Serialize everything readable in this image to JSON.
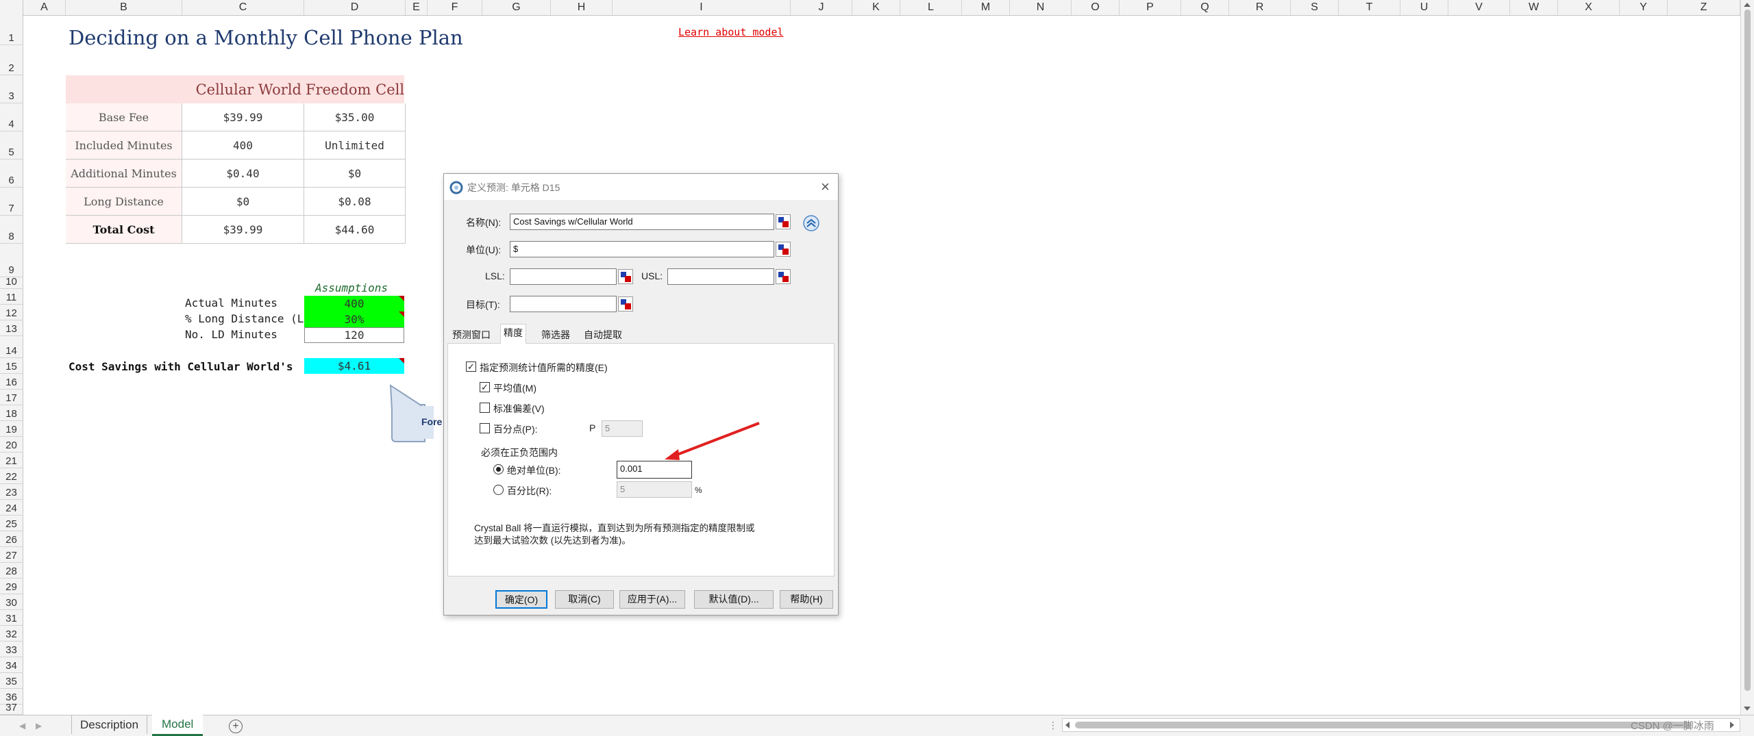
{
  "columns": [
    "A",
    "B",
    "C",
    "D",
    "E",
    "F",
    "G",
    "H",
    "I",
    "J",
    "K",
    "L",
    "M",
    "N",
    "O",
    "P",
    "Q",
    "R",
    "S",
    "T",
    "U",
    "V",
    "W",
    "X",
    "Y",
    "Z"
  ],
  "rows": [
    "1",
    "2",
    "3",
    "4",
    "5",
    "6",
    "7",
    "8",
    "9",
    "10",
    "11",
    "12",
    "13",
    "14",
    "15",
    "16",
    "17",
    "18",
    "19",
    "20",
    "21",
    "22",
    "23",
    "24",
    "25",
    "26",
    "27",
    "28",
    "29",
    "30",
    "31",
    "32",
    "33",
    "34",
    "35",
    "36",
    "37"
  ],
  "sheet": {
    "title": "Deciding on a Monthly Cell Phone Plan",
    "learn_link": "Learn about model",
    "table_headers": [
      "Cellular World",
      "Freedom Cell"
    ],
    "table_rows": [
      {
        "label": "Base Fee",
        "c": "$39.99",
        "d": "$35.00"
      },
      {
        "label": "Included Minutes",
        "c": "400",
        "d": "Unlimited"
      },
      {
        "label": "Additional Minutes",
        "c": "$0.40",
        "d": "$0"
      },
      {
        "label": "Long Distance",
        "c": "$0",
        "d": "$0.08"
      },
      {
        "label": "Total Cost",
        "c": "$39.99",
        "d": "$44.60"
      }
    ],
    "assumptions_header": "Assumptions",
    "assumptions": [
      {
        "label": "Actual Minutes",
        "value": "400"
      },
      {
        "label": "% Long Distance (LD",
        "value": "30%"
      },
      {
        "label": "No. LD Minutes",
        "value": "120"
      }
    ],
    "savings_label": "Cost Savings with Cellular World's",
    "savings_value": "$4.61",
    "callout_text": "Fore",
    "colors": {
      "green": "#00ff00",
      "cyan": "#00ffff",
      "header_pink": "#fde2e2",
      "label_pink": "#fff3f3",
      "title_blue": "#1f3a6e"
    }
  },
  "dialog": {
    "title": "定义预测: 单元格 D15",
    "name_label": "名称(N):",
    "name_value": "Cost Savings w/Cellular World",
    "unit_label": "单位(U):",
    "unit_value": "$",
    "lsl_label": "LSL:",
    "usl_label": "USL:",
    "target_label": "目标(T):",
    "tabs": [
      "预测窗口",
      "精度",
      "筛选器",
      "自动提取"
    ],
    "active_tab": "精度",
    "specify_label": "指定预测统计值所需的精度(E)",
    "mean_label": "平均值(M)",
    "std_label": "标准偏差(V)",
    "pct_label": "百分点(P):",
    "p_label": "P",
    "p_value": "5",
    "range_label": "必须在正负范围内",
    "abs_label": "绝对单位(B):",
    "abs_value": "0.001",
    "rel_label": "百分比(R):",
    "rel_value": "5",
    "percent_sign": "%",
    "note_line1": "Crystal Ball 将一直运行模拟，直到达到为所有预测指定的精度限制或",
    "note_line2": "达到最大试验次数 (以先达到者为准)。",
    "buttons": [
      "确定(O)",
      "取消(C)",
      "应用于(A)...",
      "默认值(D)...",
      "帮助(H)"
    ]
  },
  "sheet_tabs": [
    "Description",
    "Model"
  ],
  "active_sheet": "Model",
  "watermark": "CSDN @一脚冰雨"
}
